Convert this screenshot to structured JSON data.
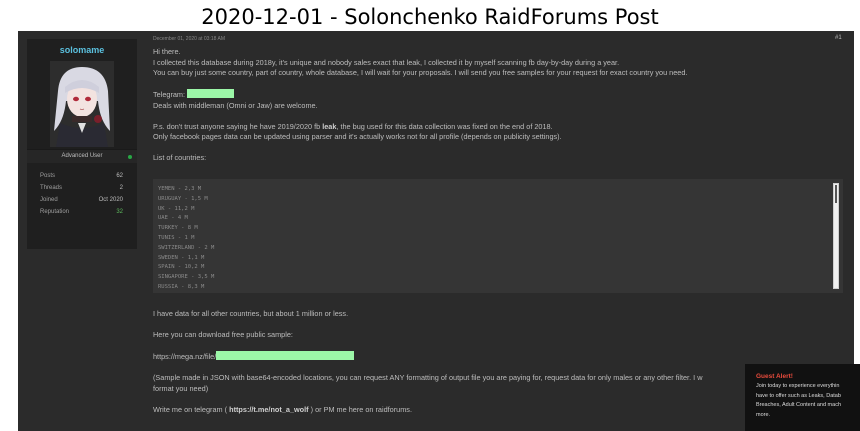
{
  "caption": "2020-12-01 - Solonchenko RaidForums Post",
  "user": {
    "name": "solomame",
    "rank": "Advanced User",
    "stats": [
      {
        "label": "Posts",
        "value": "62"
      },
      {
        "label": "Threads",
        "value": "2"
      },
      {
        "label": "Joined",
        "value": "Oct 2020"
      },
      {
        "label": "Reputation",
        "value": "32"
      }
    ],
    "status_color": "#28a745"
  },
  "post": {
    "date": "December 01, 2020 at 03:18 AM",
    "number": "#1",
    "intro": [
      "Hi there.",
      "I collected this database during 2018y, it's unique and nobody sales exact that leak, I collected it by myself scanning fb day-by-day during a year.",
      "You can buy just some country, part of country, whole database, I will wait for your proposals. I will send you free samples for your request for exact country you need."
    ],
    "telegram_label": "Telegram:",
    "middleman": "Deals with middleman (Omni or Jaw) are welcome.",
    "ps_before": "P.s. don't trust anyone saying he have 2019/2020 fb ",
    "ps_bold": "leak",
    "ps_after": ", the bug used for this data collection was fixed on the end of 2018.",
    "ps_line2": "Only facebook pages data can be updated using parser and it's actually works not for all profile (depends on publicity settings).",
    "countries_heading": "List of countries:",
    "countries": [
      "YEMEN - 2,3 M",
      "URUGUAY - 1,5 M",
      "UK - 11,2 M",
      "UAE - 4 M",
      "TURKEY - 8 M",
      "TUNIS - 1 M",
      "SWITZERLAND - 2 M",
      "SWEDEN - 1,1 M",
      "SPAIN - 10,2 M",
      "SINGAPORE - 3,5 M",
      "RUSSIA - 8,3 M"
    ],
    "other_countries": "I have data for all other countries, but about 1 million or less.",
    "download_text": "Here you can download free public sample:",
    "mega_link": "https://mega.nz/file/",
    "sample_note_1": "(Sample made in JSON with base64-encoded locations, you can request ANY formatting of output file you are paying for, request data for only males or any other filter. I w",
    "sample_note_2": "format you need)",
    "contact_before": "Write me on telegram ( ",
    "contact_link": "https://t.me/not_a_wolf",
    "contact_after": " ) or PM me here on raidforums."
  },
  "guest_alert": {
    "title": "Guest Alert!",
    "lines": [
      "Join today to experience everythin",
      "have to offer such as Leaks, Datab",
      "Breaches, Adult Content and mach",
      "more."
    ]
  },
  "colors": {
    "redaction": "#9cf7a8",
    "username": "#5bc0de",
    "alert_title": "#e94b3c"
  }
}
